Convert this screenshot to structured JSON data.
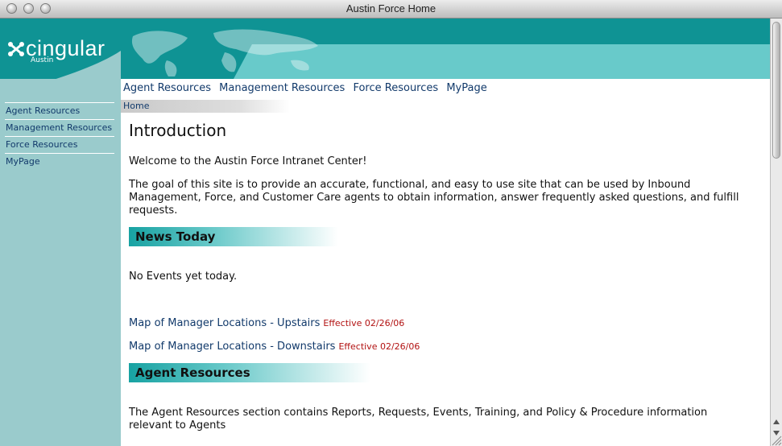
{
  "window": {
    "title": "Austin Force Home"
  },
  "logo": {
    "brand": "cingular",
    "sub": "Austin"
  },
  "sidebar": {
    "items": [
      "Agent Resources",
      "Management Resources",
      "Force Resources",
      "MyPage"
    ]
  },
  "topnav": {
    "items": [
      "Agent Resources",
      "Management Resources",
      "Force Resources",
      "MyPage"
    ]
  },
  "breadcrumb": {
    "home": "Home"
  },
  "main": {
    "heading": "Introduction",
    "welcome": "Welcome to the Austin Force Intranet Center!",
    "goal_line1": "The goal of this site is to provide an accurate, functional, and easy to use site that can be used by Inbound",
    "goal_line2": "Management, Force, and Customer Care agents to obtain information, answer frequently asked questions, and fulfill",
    "goal_line3": "requests.",
    "news_title": "News Today",
    "no_events": "No Events yet today.",
    "links": [
      {
        "text": "Map of Manager Locations - Upstairs",
        "effective": "Effective 02/26/06"
      },
      {
        "text": "Map of Manager Locations - Downstairs",
        "effective": "Effective 02/26/06"
      }
    ],
    "agent_title": "Agent Resources",
    "agent_line1": "The Agent Resources section contains Reports, Requests, Events, Training, and Policy & Procedure information",
    "agent_line2": "relevant to Agents"
  },
  "colors": {
    "teal_dark": "#0f9394",
    "teal_light": "#68caca",
    "sidebar": "#9acbcc",
    "link": "#123a6b",
    "effective": "#b21212"
  }
}
